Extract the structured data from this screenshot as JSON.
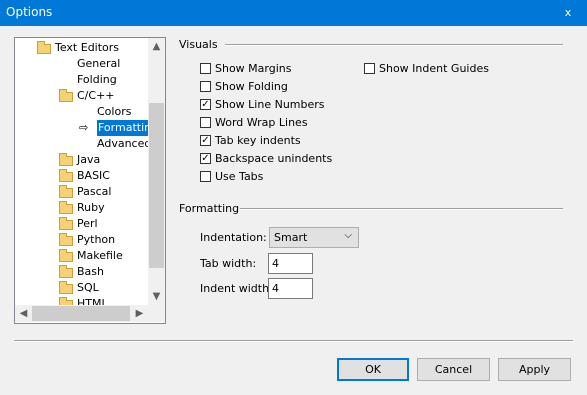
{
  "window": {
    "title": "Options",
    "close_label": "x"
  },
  "tree": {
    "items": [
      {
        "label": "Text Editors",
        "icon": "folder-open-icon"
      },
      {
        "label": "General"
      },
      {
        "label": "Folding"
      },
      {
        "label": "C/C++",
        "icon": "folder-open-icon"
      },
      {
        "label": "Colors"
      },
      {
        "label": "Formatting",
        "selected": true
      },
      {
        "label": "Advanced"
      },
      {
        "label": "Java",
        "icon": "folder-icon"
      },
      {
        "label": "BASIC",
        "icon": "folder-icon"
      },
      {
        "label": "Pascal",
        "icon": "folder-icon"
      },
      {
        "label": "Ruby",
        "icon": "folder-icon"
      },
      {
        "label": "Perl",
        "icon": "folder-icon"
      },
      {
        "label": "Python",
        "icon": "folder-icon"
      },
      {
        "label": "Makefile",
        "icon": "folder-icon"
      },
      {
        "label": "Bash",
        "icon": "folder-icon"
      },
      {
        "label": "SQL",
        "icon": "folder-icon"
      },
      {
        "label": "HTML",
        "icon": "folder-icon"
      }
    ]
  },
  "visuals": {
    "heading": "Visuals",
    "options": [
      {
        "label": "Show Margins",
        "checked": false
      },
      {
        "label": "Show Folding",
        "checked": false
      },
      {
        "label": "Show Line Numbers",
        "checked": true
      },
      {
        "label": "Word Wrap Lines",
        "checked": false
      },
      {
        "label": "Tab key indents",
        "checked": true
      },
      {
        "label": "Backspace unindents",
        "checked": true
      },
      {
        "label": "Use Tabs",
        "checked": false
      },
      {
        "label": "Show Indent Guides",
        "checked": false
      }
    ]
  },
  "formatting": {
    "heading": "Formatting",
    "indentation_label": "Indentation:",
    "indentation_value": "Smart",
    "tab_width_label": "Tab width:",
    "tab_width_value": "4",
    "indent_width_label": "Indent width:",
    "indent_width_value": "4"
  },
  "buttons": {
    "ok": "OK",
    "cancel": "Cancel",
    "apply": "Apply"
  }
}
